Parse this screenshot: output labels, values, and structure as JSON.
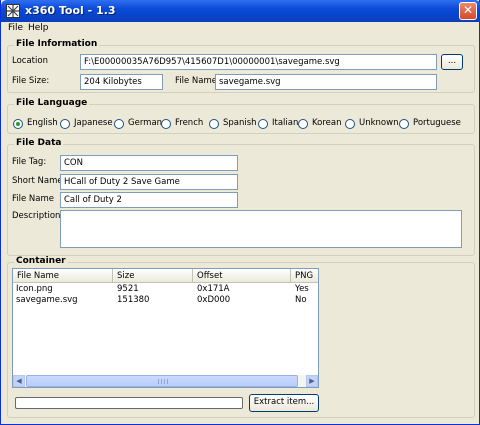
{
  "window": {
    "title": "x360 Tool - 1.3"
  },
  "menu": [
    "File",
    "Help"
  ],
  "file_information": {
    "label": "File Information",
    "location_label": "Location",
    "location_value": "F:\\E00000035A76D957\\415607D1\\00000001\\savegame.svg",
    "browse_label": "...",
    "file_size_label": "File Size:",
    "file_size_value": "204 Kilobytes",
    "file_name_label": "File Name",
    "file_name_value": "savegame.svg"
  },
  "file_language": {
    "label": "File Language",
    "selected": "English",
    "options": [
      "English",
      "Japanese",
      "German",
      "French",
      "Spanish",
      "Italian",
      "Korean",
      "Unknown",
      "Portuguese"
    ]
  },
  "file_data": {
    "label": "File Data",
    "file_tag_label": "File Tag:",
    "file_tag_value": "CON",
    "short_name_label": "Short Name",
    "short_name_value": "HCall of Duty 2 Save Game",
    "file_name_label": "File Name",
    "file_name_value": "Call of Duty 2",
    "description_label": "Description",
    "description_value": ""
  },
  "container": {
    "label": "Container",
    "columns": [
      "File Name",
      "Size",
      "Offset",
      "PNG"
    ],
    "rows": [
      [
        "Icon.png",
        "9521",
        "0x171A",
        "Yes"
      ],
      [
        "savegame.svg",
        "151380",
        "0xD000",
        "No"
      ]
    ],
    "progress": 0,
    "extract_label": "Extract item..."
  },
  "icons": {
    "app": "x360-logo-icon",
    "close": "close-icon"
  }
}
